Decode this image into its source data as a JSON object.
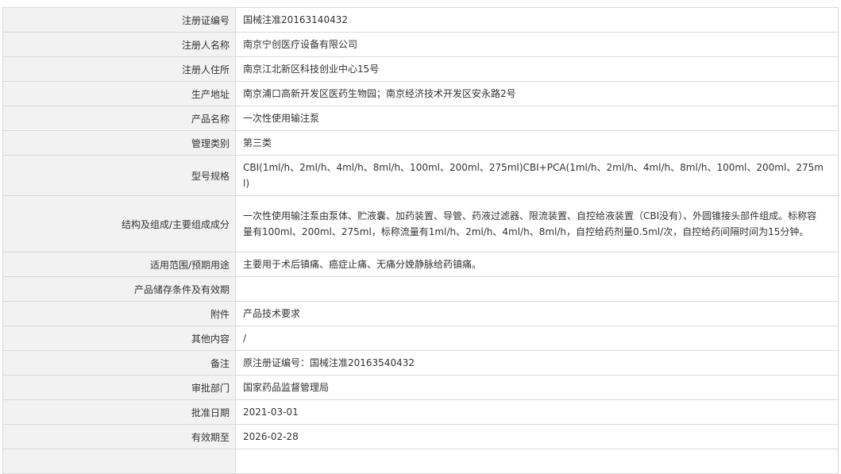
{
  "record": {
    "rows": [
      {
        "label": "注册证编号",
        "value": "国械注准20163140432"
      },
      {
        "label": "注册人名称",
        "value": "南京宁创医疗设备有限公司"
      },
      {
        "label": "注册人住所",
        "value": "南京江北新区科技创业中心15号"
      },
      {
        "label": "生产地址",
        "value": "南京浦口高新开发区医药生物园；南京经济技术开发区安永路2号"
      },
      {
        "label": "产品名称",
        "value": "一次性使用输注泵"
      },
      {
        "label": "管理类别",
        "value": "第三类"
      },
      {
        "label": "型号规格",
        "value": "CBI(1ml/h、2ml/h、4ml/h、8ml/h、100ml、200ml、275ml)CBI+PCA(1ml/h、2ml/h、4ml/h、8ml/h、100ml、200ml、275ml)"
      },
      {
        "label": "结构及组成/主要组成成分",
        "value": "一次性使用输注泵由泵体、贮液囊、加药装置、导管、药液过滤器、限流装置、自控给液装置（CBI没有）、外圆锥接头部件组成。标称容量有100ml、200ml、275ml，标称流量有1ml/h、2ml/h、4ml/h、8ml/h，自控给药剂量0.5ml/次，自控给药间隔时间为15分钟。"
      },
      {
        "label": "适用范围/预期用途",
        "value": "主要用于术后镇痛、癌症止痛、无痛分娩静脉给药镇痛。"
      },
      {
        "label": "产品储存条件及有效期",
        "value": ""
      },
      {
        "label": "附件",
        "value": "产品技术要求"
      },
      {
        "label": "其他内容",
        "value": "/"
      },
      {
        "label": "备注",
        "value": "原注册证编号：国械注准20163540432"
      },
      {
        "label": "审批部门",
        "value": "国家药品监督管理局"
      },
      {
        "label": "批准日期",
        "value": "2021-03-01"
      },
      {
        "label": "有效期至",
        "value": "2026-02-28"
      },
      {
        "label": "",
        "value": ""
      }
    ]
  }
}
